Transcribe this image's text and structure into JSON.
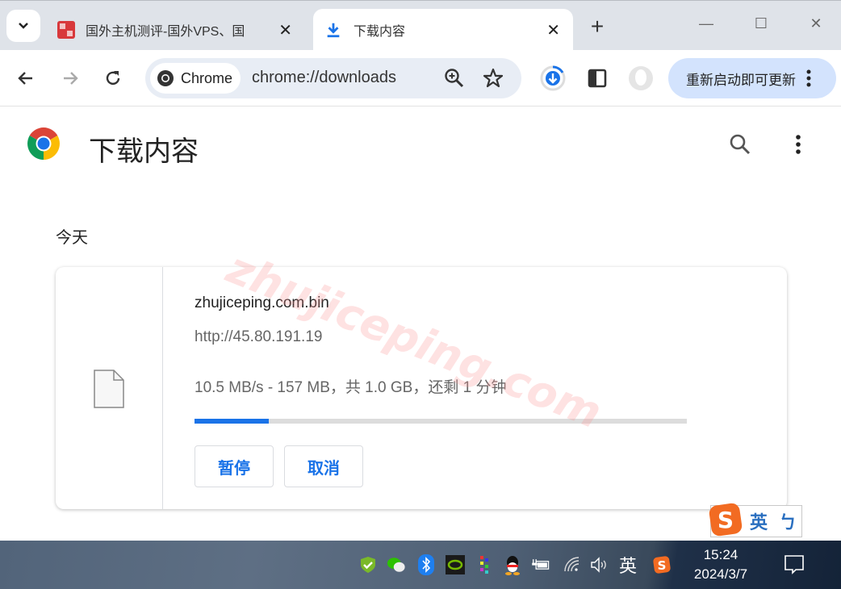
{
  "tabs": [
    {
      "title": "国外主机测评-国外VPS、国",
      "close": "✕",
      "active": false
    },
    {
      "title": "下载内容",
      "close": "✕",
      "active": true
    }
  ],
  "window": {
    "new_tab": "+",
    "minimize": "—",
    "maximize": "☐",
    "close": "✕"
  },
  "omnibox": {
    "chip_label": "Chrome",
    "url": "chrome://downloads"
  },
  "toolbar": {
    "update_label": "重新启动即可更新"
  },
  "page": {
    "title": "下载内容",
    "date_group": "今天",
    "download": {
      "file_name": "zhujiceping.com.bin",
      "source_url": "http://45.80.191.19",
      "status": "10.5 MB/s - 157 MB，共 1.0 GB，还剩 1 分钟",
      "progress_percent": 15,
      "pause_label": "暂停",
      "cancel_label": "取消"
    }
  },
  "watermark": "zhujiceping.com",
  "ime": {
    "mode": "英",
    "punct": "ㄅ"
  },
  "taskbar": {
    "ime_label": "英",
    "time": "15:24",
    "date": "2024/3/7"
  },
  "colors": {
    "accent": "#1a73e8",
    "update_bg": "#d3e3fd",
    "titlebar_bg": "#dfe3e9",
    "omnibox_bg": "#e8edf5"
  }
}
